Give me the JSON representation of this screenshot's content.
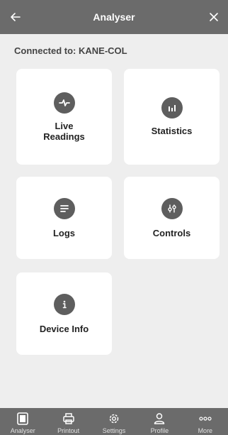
{
  "header": {
    "title": "Analyser"
  },
  "connection": {
    "text": "Connected to: KANE-COL"
  },
  "tiles": [
    {
      "label": "Live\nReadings",
      "line1": "Live",
      "line2": "Readings"
    },
    {
      "label": "Statistics"
    },
    {
      "label": "Logs"
    },
    {
      "label": "Controls"
    },
    {
      "label": "Device Info"
    }
  ],
  "bottom_nav": [
    {
      "label": "Analyser",
      "icon": "tablet-icon"
    },
    {
      "label": "Printout",
      "icon": "printer-icon"
    },
    {
      "label": "Settings",
      "icon": "gear-icon"
    },
    {
      "label": "Profile",
      "icon": "person-icon"
    },
    {
      "label": "More",
      "icon": "more-icon"
    }
  ],
  "colors": {
    "bar": "#6b6b6b",
    "background": "#eeeeee",
    "tile": "#ffffff",
    "icon_circle": "#5e5e5e"
  }
}
